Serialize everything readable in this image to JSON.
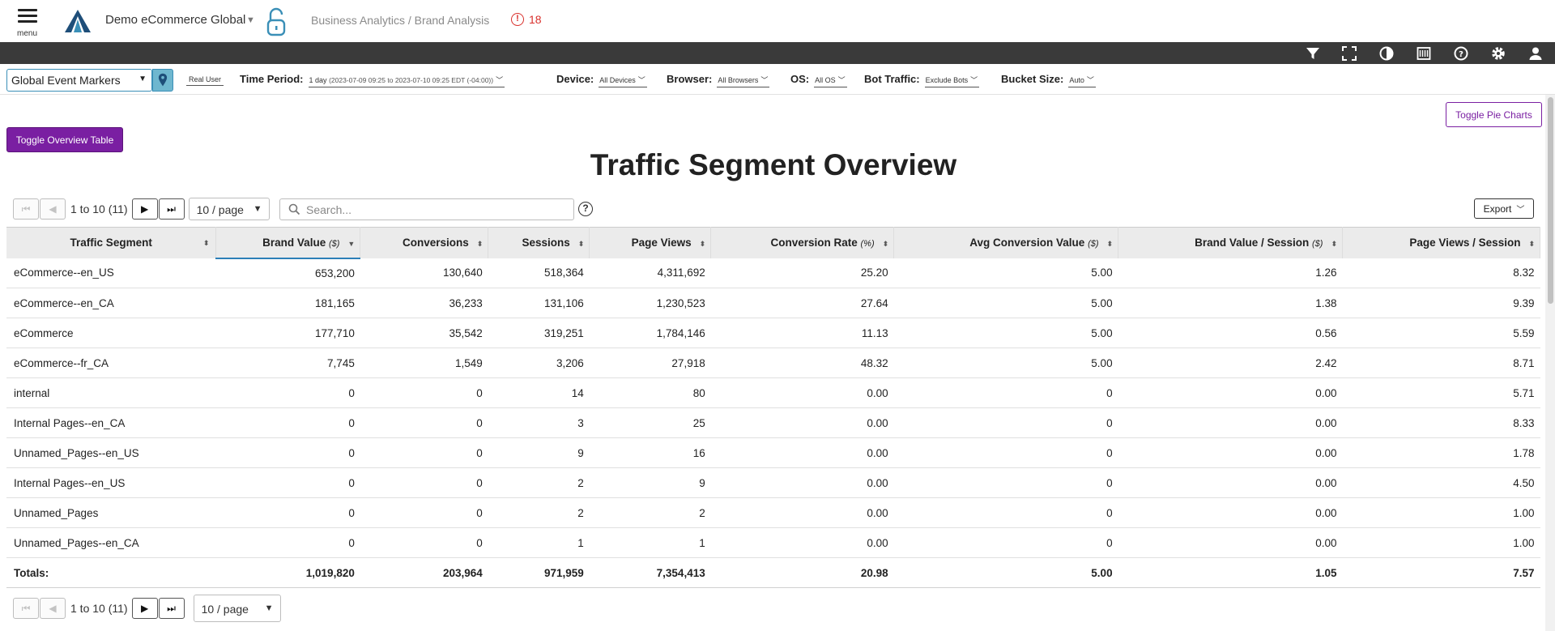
{
  "header": {
    "menu_label": "menu",
    "org_name": "Demo eCommerce Global",
    "breadcrumb": "Business Analytics / Brand Analysis",
    "alert_count": "18",
    "colors": {
      "accent": "#7a1fa2",
      "alert": "#d9302c",
      "lock": "#3a8fb7"
    }
  },
  "toolbar_icons": [
    "filter-icon",
    "fullscreen-icon",
    "contrast-icon",
    "report-icon",
    "help-icon",
    "gear-icon",
    "user-icon"
  ],
  "filters": {
    "event_markers": "Global Event Markers",
    "real_user": "Real User",
    "time_period_label": "Time Period:",
    "time_period_value": "1 day",
    "time_period_range": "(2023-07-09 09:25 to 2023-07-10 09:25 EDT (-04:00))",
    "device_label": "Device:",
    "device_value": "All Devices",
    "browser_label": "Browser:",
    "browser_value": "All Browsers",
    "os_label": "OS:",
    "os_value": "All OS",
    "bot_label": "Bot Traffic:",
    "bot_value": "Exclude Bots",
    "bucket_label": "Bucket Size:",
    "bucket_value": "Auto"
  },
  "main": {
    "toggle_table": "Toggle Overview Table",
    "toggle_pie": "Toggle Pie Charts",
    "title": "Traffic Segment Overview",
    "pager_info": "1 to 10 (11)",
    "per_page": "10 / page",
    "search_placeholder": "Search...",
    "export": "Export"
  },
  "table": {
    "columns": [
      {
        "name": "Traffic Segment",
        "unit": ""
      },
      {
        "name": "Brand Value",
        "unit": "($)"
      },
      {
        "name": "Conversions",
        "unit": ""
      },
      {
        "name": "Sessions",
        "unit": ""
      },
      {
        "name": "Page Views",
        "unit": ""
      },
      {
        "name": "Conversion Rate",
        "unit": "(%)"
      },
      {
        "name": "Avg Conversion Value",
        "unit": "($)"
      },
      {
        "name": "Brand Value / Session",
        "unit": "($)"
      },
      {
        "name": "Page Views / Session",
        "unit": ""
      }
    ],
    "rows": [
      [
        "eCommerce--en_US",
        "653,200",
        "130,640",
        "518,364",
        "4,311,692",
        "25.20",
        "5.00",
        "1.26",
        "8.32"
      ],
      [
        "eCommerce--en_CA",
        "181,165",
        "36,233",
        "131,106",
        "1,230,523",
        "27.64",
        "5.00",
        "1.38",
        "9.39"
      ],
      [
        "eCommerce",
        "177,710",
        "35,542",
        "319,251",
        "1,784,146",
        "11.13",
        "5.00",
        "0.56",
        "5.59"
      ],
      [
        "eCommerce--fr_CA",
        "7,745",
        "1,549",
        "3,206",
        "27,918",
        "48.32",
        "5.00",
        "2.42",
        "8.71"
      ],
      [
        "internal",
        "0",
        "0",
        "14",
        "80",
        "0.00",
        "0",
        "0.00",
        "5.71"
      ],
      [
        "Internal Pages--en_CA",
        "0",
        "0",
        "3",
        "25",
        "0.00",
        "0",
        "0.00",
        "8.33"
      ],
      [
        "Unnamed_Pages--en_US",
        "0",
        "0",
        "9",
        "16",
        "0.00",
        "0",
        "0.00",
        "1.78"
      ],
      [
        "Internal Pages--en_US",
        "0",
        "0",
        "2",
        "9",
        "0.00",
        "0",
        "0.00",
        "4.50"
      ],
      [
        "Unnamed_Pages",
        "0",
        "0",
        "2",
        "2",
        "0.00",
        "0",
        "0.00",
        "1.00"
      ],
      [
        "Unnamed_Pages--en_CA",
        "0",
        "0",
        "1",
        "1",
        "0.00",
        "0",
        "0.00",
        "1.00"
      ]
    ],
    "totals": [
      "Totals:",
      "1,019,820",
      "203,964",
      "971,959",
      "7,354,413",
      "20.98",
      "5.00",
      "1.05",
      "7.57"
    ]
  }
}
